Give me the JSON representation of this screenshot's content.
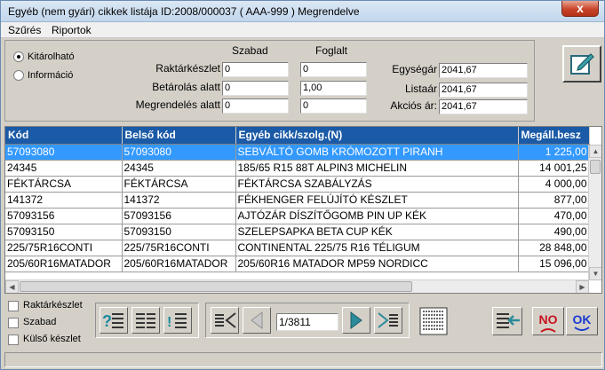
{
  "window": {
    "title": "Egyéb (nem gyári) cikkek listája  ID:2008/000037 ( AAA-999     )  Megrendelve",
    "close_label": "x"
  },
  "menu": [
    {
      "label": "Szűrés"
    },
    {
      "label": "Riportok"
    }
  ],
  "filter_panel": {
    "radio_options": [
      {
        "label": "Kitárolható",
        "selected": true
      },
      {
        "label": "Információ",
        "selected": false
      }
    ],
    "col_headers": {
      "free": "Szabad",
      "reserved": "Foglalt"
    },
    "rows": [
      {
        "label": "Raktárkészlet",
        "free": "0",
        "reserved": "0"
      },
      {
        "label": "Betárolás alatt",
        "free": "0",
        "reserved": "1,00"
      },
      {
        "label": "Megrendelés alatt",
        "free": "0",
        "reserved": "0"
      }
    ],
    "prices": [
      {
        "label": "Egységár",
        "value": "2041,67"
      },
      {
        "label": "Listaár",
        "value": "2041,67"
      },
      {
        "label": "Akciós ár:",
        "value": "2041,67"
      }
    ]
  },
  "grid": {
    "headers": [
      "Kód",
      "Belső kód",
      "Egyéb cikk/szolg.(N)",
      "Megáll.besz"
    ],
    "rows": [
      {
        "kod": "57093080",
        "belso": "57093080",
        "nev": "SEBVÁLTÓ GOMB KRÓMOZOTT PIRANH",
        "ar": "1 225,00"
      },
      {
        "kod": "24345",
        "belso": "24345",
        "nev": "185/65 R15 88T ALPIN3 MICHELIN",
        "ar": "14 001,25"
      },
      {
        "kod": "FÉKTÁRCSA",
        "belso": "FÉKTÁRCSA",
        "nev": "FÉKTÁRCSA SZABÁLYZÁS",
        "ar": "4 000,00"
      },
      {
        "kod": "141372",
        "belso": "141372",
        "nev": "FÉKHENGER FELÚJÍTÓ KÉSZLET",
        "ar": "877,00"
      },
      {
        "kod": "57093156",
        "belso": "57093156",
        "nev": "AJTÓZÁR DÍSZÍTŐGOMB PIN UP KÉK",
        "ar": "470,00"
      },
      {
        "kod": "57093150",
        "belso": "57093150",
        "nev": "SZELEPSAPKA BETA CUP KÉK",
        "ar": "490,00"
      },
      {
        "kod": "225/75R16CONTI",
        "belso": "225/75R16CONTI",
        "nev": "CONTINENTAL 225/75 R16 TÉLIGUM",
        "ar": "28 848,00"
      },
      {
        "kod": "205/60R16MATADOR",
        "belso": "205/60R16MATADOR",
        "nev": "205/60R16 MATADOR MP59 NORDICC",
        "ar": "15 096,00"
      }
    ],
    "selected_index": 0
  },
  "bottom": {
    "checkboxes": [
      {
        "label": "Raktárkészlet"
      },
      {
        "label": "Szabad"
      },
      {
        "label": "Külső készlet"
      }
    ],
    "record_counter": "1/3811",
    "no_label": "NO",
    "ok_label": "OK"
  },
  "colors": {
    "header_blue": "#1a5aa6",
    "selection": "#3399ff",
    "panel": "#d4d0c8"
  }
}
